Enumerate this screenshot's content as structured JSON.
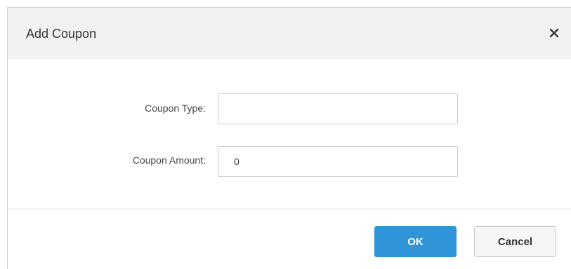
{
  "dialog": {
    "title": "Add Coupon",
    "close_icon": "close-icon"
  },
  "form": {
    "coupon_type_label": "Coupon Type:",
    "coupon_type_value": "",
    "coupon_amount_label": "Coupon Amount:",
    "coupon_amount_value": "0"
  },
  "footer": {
    "ok_label": "OK",
    "cancel_label": "Cancel"
  },
  "colors": {
    "header_bg": "#f2f2f2",
    "primary": "#2f95d8",
    "border": "#cccccc"
  }
}
